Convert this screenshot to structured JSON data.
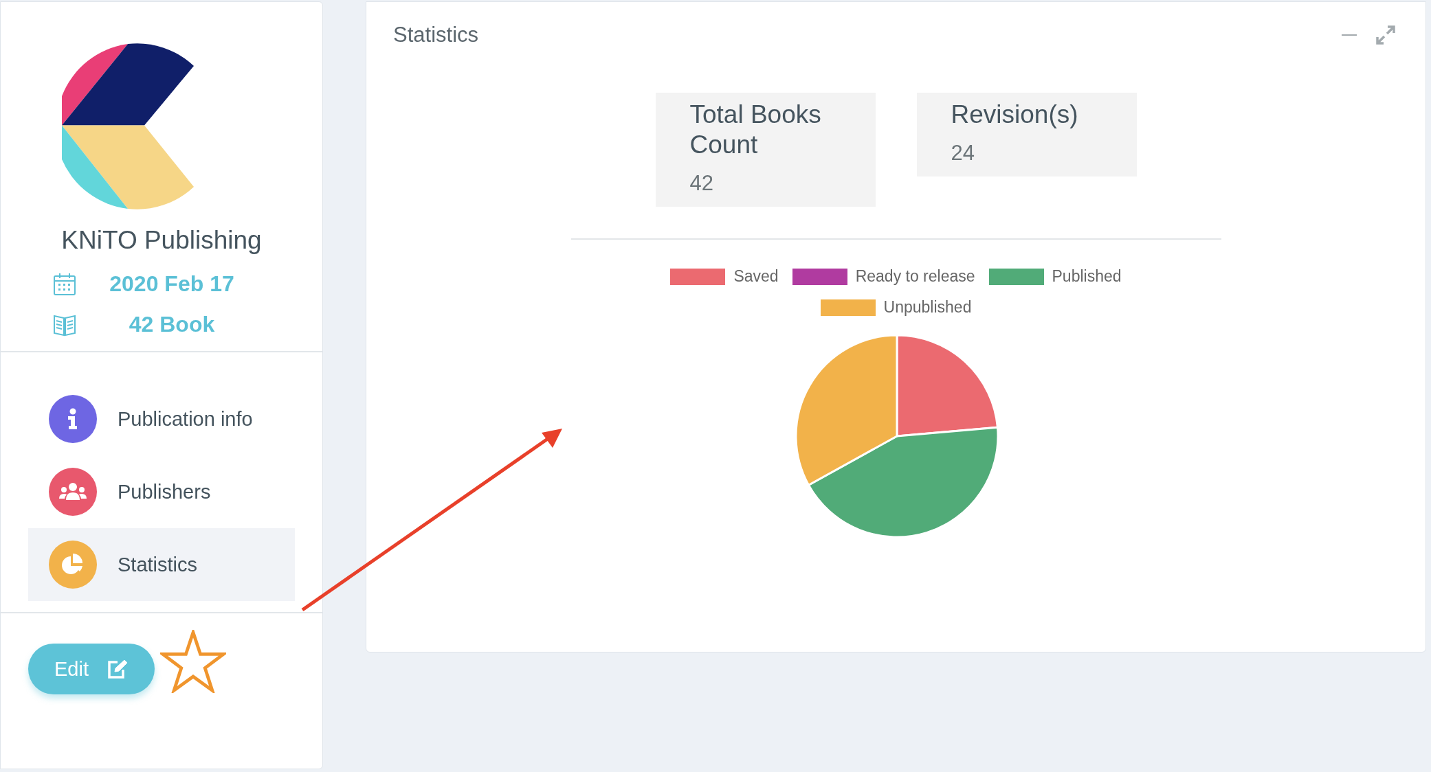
{
  "profile": {
    "name": "KNiTO Publishing",
    "facts": [
      {
        "kind": "date",
        "text": "2020 Feb 17"
      },
      {
        "kind": "books",
        "text": "42 Book"
      }
    ]
  },
  "sidebar": {
    "items": [
      {
        "kind": "info",
        "label": "Publication info",
        "color": "#6e66e3",
        "selected": false
      },
      {
        "kind": "people",
        "label": "Publishers",
        "color": "#e8586d",
        "selected": false
      },
      {
        "kind": "pie",
        "label": "Statistics",
        "color": "#f2b24a",
        "selected": true
      }
    ]
  },
  "edit_button": {
    "label": "Edit"
  },
  "favorite": {
    "starred": false
  },
  "panel": {
    "title": "Statistics",
    "stats": [
      {
        "label": "Total Books Count",
        "value": "42"
      },
      {
        "label": "Revision(s)",
        "value": "24"
      }
    ],
    "legend": [
      {
        "label": "Saved",
        "color": "#eb6a70"
      },
      {
        "label": "Ready to release",
        "color": "#b03ba0"
      },
      {
        "label": "Published",
        "color": "#51ab78"
      },
      {
        "label": "Unpublished",
        "color": "#f2b24a"
      }
    ]
  }
}
